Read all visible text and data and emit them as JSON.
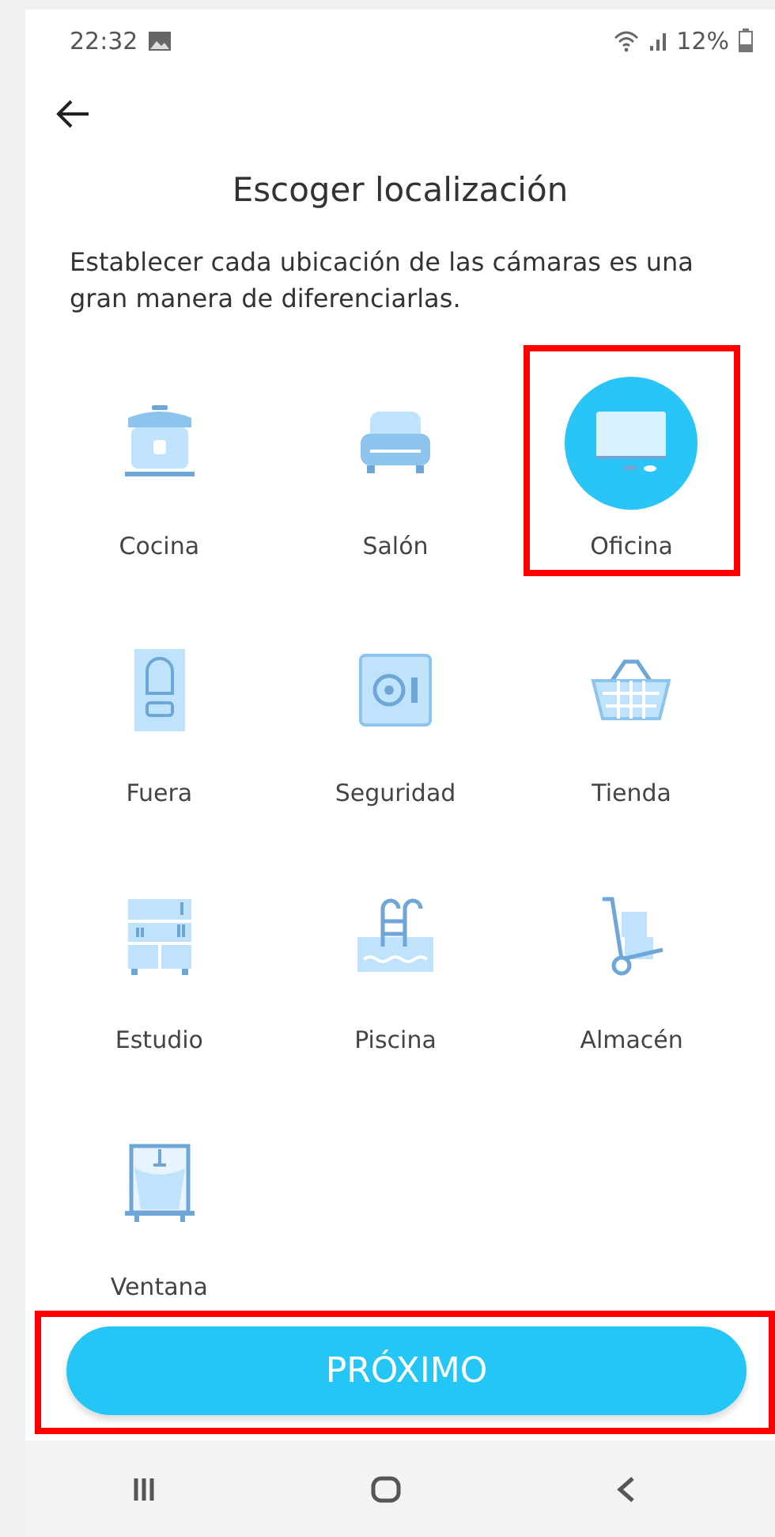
{
  "status_bar": {
    "time": "22:32",
    "battery": "12%"
  },
  "title": "Escoger localización",
  "description": "Establecer cada ubicación de las cámaras es una gran manera de diferenciarlas.",
  "locations": [
    {
      "label": "Cocina",
      "selected": false,
      "highlighted": false
    },
    {
      "label": "Salón",
      "selected": false,
      "highlighted": false
    },
    {
      "label": "Oficina",
      "selected": true,
      "highlighted": true
    },
    {
      "label": "Fuera",
      "selected": false,
      "highlighted": false
    },
    {
      "label": "Seguridad",
      "selected": false,
      "highlighted": false
    },
    {
      "label": "Tienda",
      "selected": false,
      "highlighted": false
    },
    {
      "label": "Estudio",
      "selected": false,
      "highlighted": false
    },
    {
      "label": "Piscina",
      "selected": false,
      "highlighted": false
    },
    {
      "label": "Almacén",
      "selected": false,
      "highlighted": false
    },
    {
      "label": "Ventana",
      "selected": false,
      "highlighted": false
    }
  ],
  "next_button": {
    "label": "PRÓXIMO",
    "highlighted": true
  }
}
